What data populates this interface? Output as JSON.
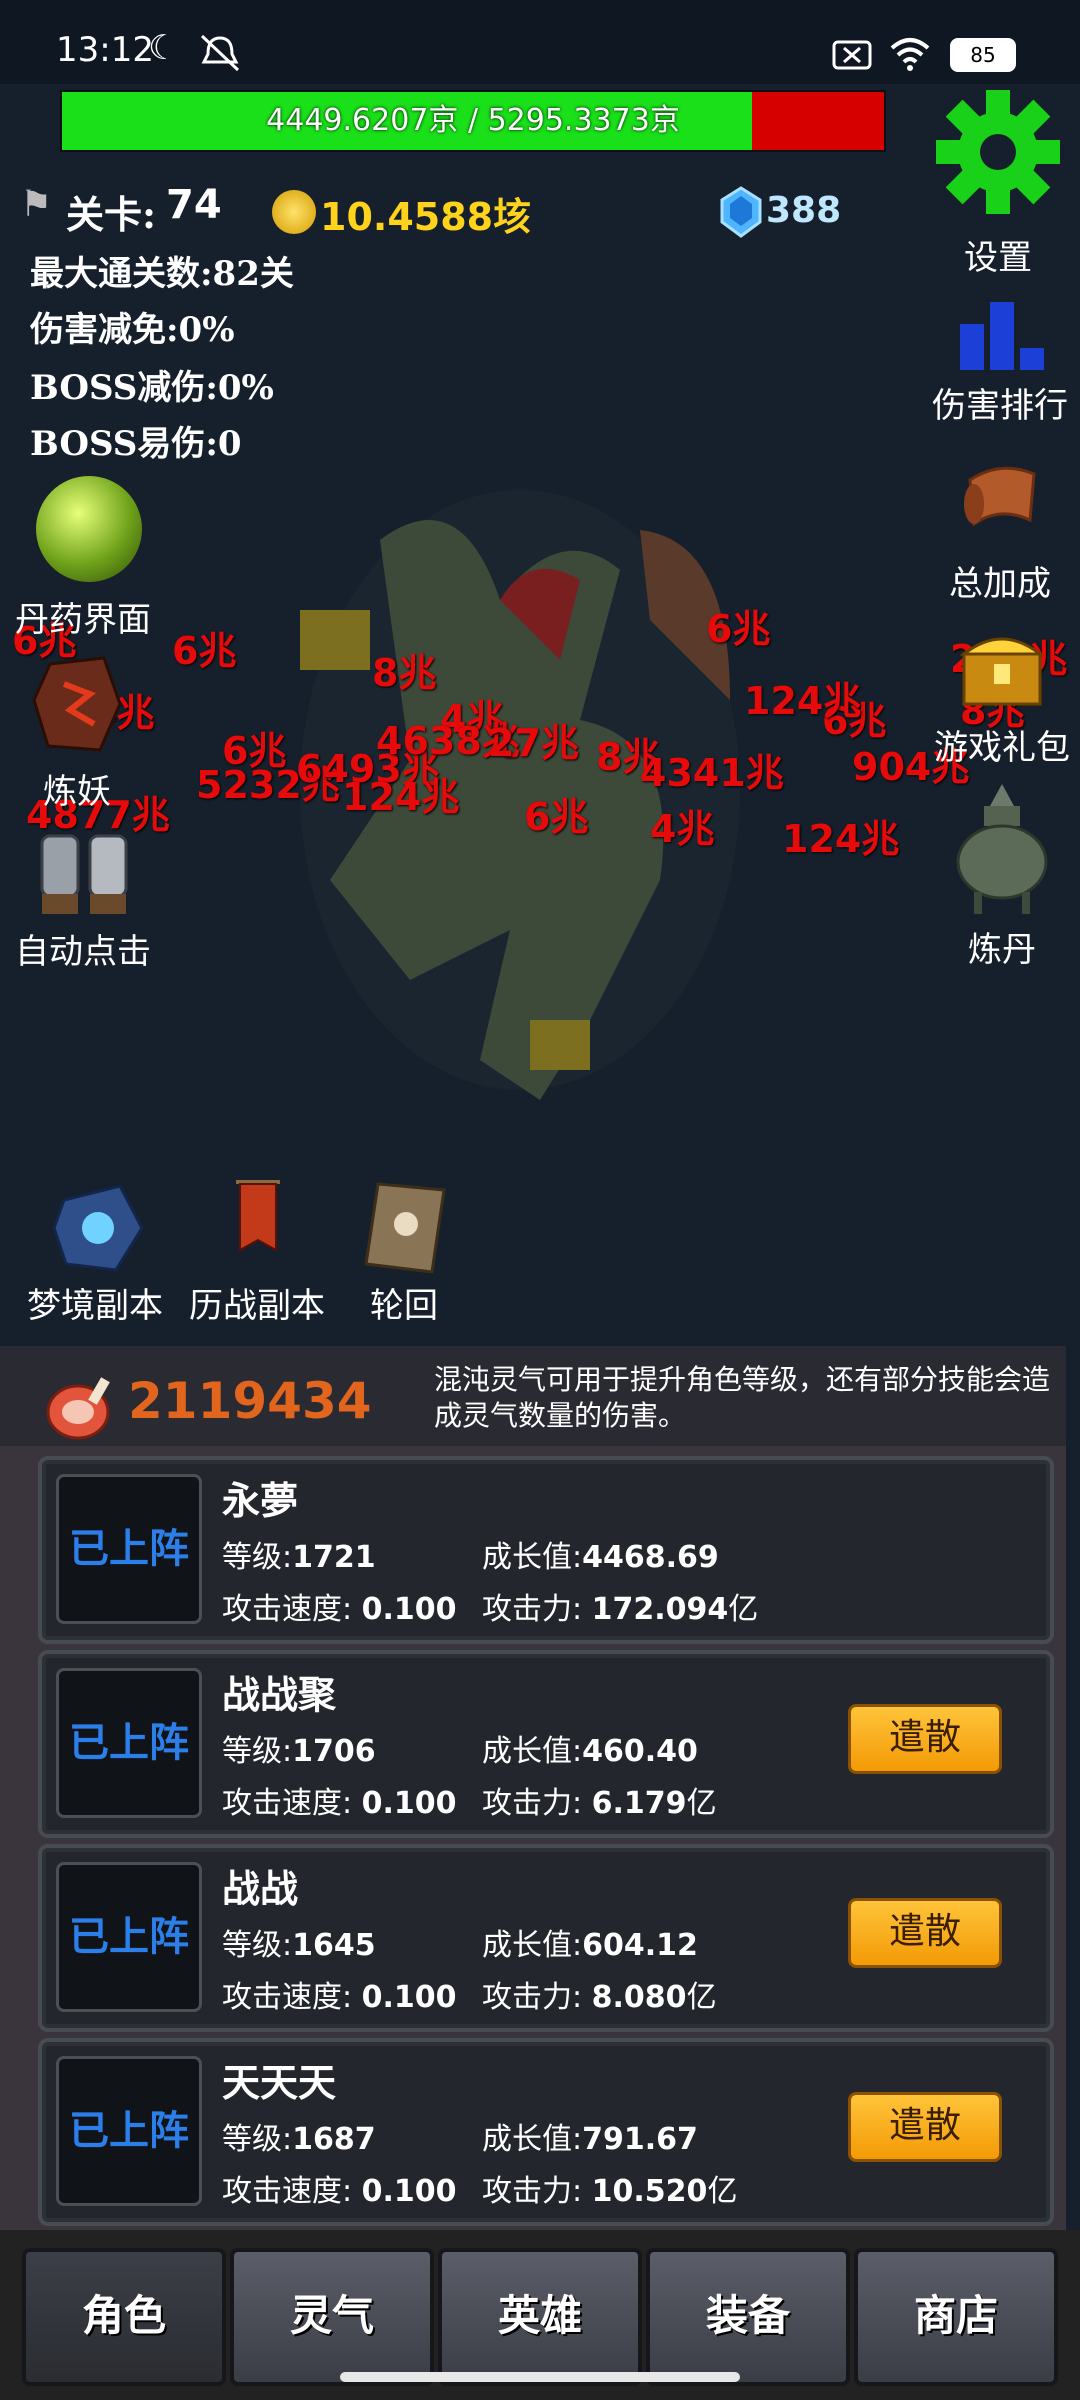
{
  "status_bar": {
    "time": "13:12",
    "battery": "85"
  },
  "boss": {
    "hp_text": "4449.6207京 / 5295.3373京",
    "hp_fraction": 0.84
  },
  "stats": {
    "stage_label": "关卡:",
    "stage_value": "74",
    "gold": "10.4588垓",
    "gems": "388",
    "max_stage": "最大通关数:82关",
    "damage_reduction": "伤害减免:0%",
    "boss_reduction": "BOSS减伤:0%",
    "boss_vulnerability": "BOSS易伤:0"
  },
  "right_menu": {
    "settings": "设置",
    "damage_rank": "伤害排行",
    "total_bonus": "总加成",
    "gift_pack": "游戏礼包",
    "alchemy": "炼丹"
  },
  "left_menu": {
    "pill_ui": "丹药界面",
    "refine_demon": "炼妖",
    "auto_click": "自动点击"
  },
  "dungeons": {
    "dream": "梦境副本",
    "battle": "历战副本",
    "reincarnation": "轮回"
  },
  "damage_numbers": [
    "6兆",
    "6兆",
    "8兆",
    "4兆",
    "6兆",
    "6兆",
    "4兆",
    "6兆",
    "5232兆",
    "6493兆",
    "124兆",
    "4638兆",
    "27兆",
    "8兆",
    "4341兆",
    "124兆",
    "4兆",
    "6兆",
    "124兆",
    "4877兆",
    "904兆",
    "270兆",
    "8兆"
  ],
  "spirit": {
    "amount": "2119434",
    "description": "混沌灵气可用于提升角色等级，还有部分技能会造成灵气数量的伤害。"
  },
  "heroes": [
    {
      "status": "已上阵",
      "name": "永夢",
      "level_label": "等级:",
      "level": "1721",
      "growth_label": "成长值:",
      "growth": "4468.69",
      "speed_label": "攻击速度:",
      "speed": "0.100",
      "attack_label": "攻击力:",
      "attack": "172.094",
      "attack_unit": "亿",
      "dismiss": ""
    },
    {
      "status": "已上阵",
      "name": "战战聚",
      "level_label": "等级:",
      "level": "1706",
      "growth_label": "成长值:",
      "growth": "460.40",
      "speed_label": "攻击速度:",
      "speed": "0.100",
      "attack_label": "攻击力:",
      "attack": "6.179",
      "attack_unit": "亿",
      "dismiss": "遣散"
    },
    {
      "status": "已上阵",
      "name": "战战",
      "level_label": "等级:",
      "level": "1645",
      "growth_label": "成长值:",
      "growth": "604.12",
      "speed_label": "攻击速度:",
      "speed": "0.100",
      "attack_label": "攻击力:",
      "attack": "8.080",
      "attack_unit": "亿",
      "dismiss": "遣散"
    },
    {
      "status": "已上阵",
      "name": "天天天",
      "level_label": "等级:",
      "level": "1687",
      "growth_label": "成长值:",
      "growth": "791.67",
      "speed_label": "攻击速度:",
      "speed": "0.100",
      "attack_label": "攻击力:",
      "attack": "10.520",
      "attack_unit": "亿",
      "dismiss": "遣散"
    }
  ],
  "tabs": [
    "角色",
    "灵气",
    "英雄",
    "装备",
    "商店"
  ]
}
